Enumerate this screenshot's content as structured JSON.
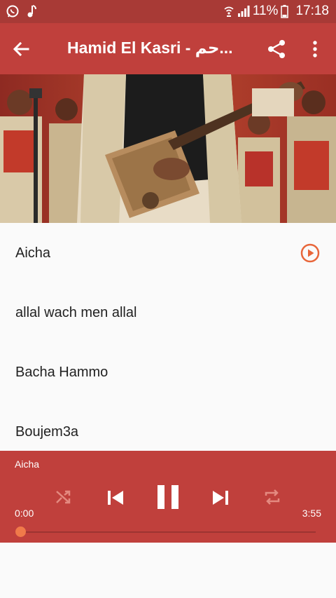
{
  "status_bar": {
    "battery": "11%",
    "time": "17:18",
    "icons": [
      "whatsapp-icon",
      "music-note-icon",
      "wifi-calling-icon",
      "signal-icon",
      "battery-icon"
    ]
  },
  "app_bar": {
    "title": "Hamid El Kasri - حم...",
    "back_icon": "arrow-back-icon",
    "share_icon": "share-icon",
    "more_icon": "more-vert-icon"
  },
  "cover": {
    "description_icon": "cover-art"
  },
  "tracks": [
    {
      "title": "Aicha"
    },
    {
      "title": "allal wach men allal"
    },
    {
      "title": "Bacha Hammo"
    },
    {
      "title": "Boujem3a"
    }
  ],
  "player": {
    "now_playing": "Aicha",
    "current_time": "0:00",
    "total_time": "3:55",
    "progress": 0,
    "icons": [
      "shuffle-icon",
      "skip-previous-icon",
      "pause-icon",
      "skip-next-icon",
      "repeat-icon"
    ]
  },
  "colors": {
    "primary": "#c0403c",
    "status_bar": "#a83a36",
    "accent": "#f07a4a",
    "background": "#fafafa"
  }
}
